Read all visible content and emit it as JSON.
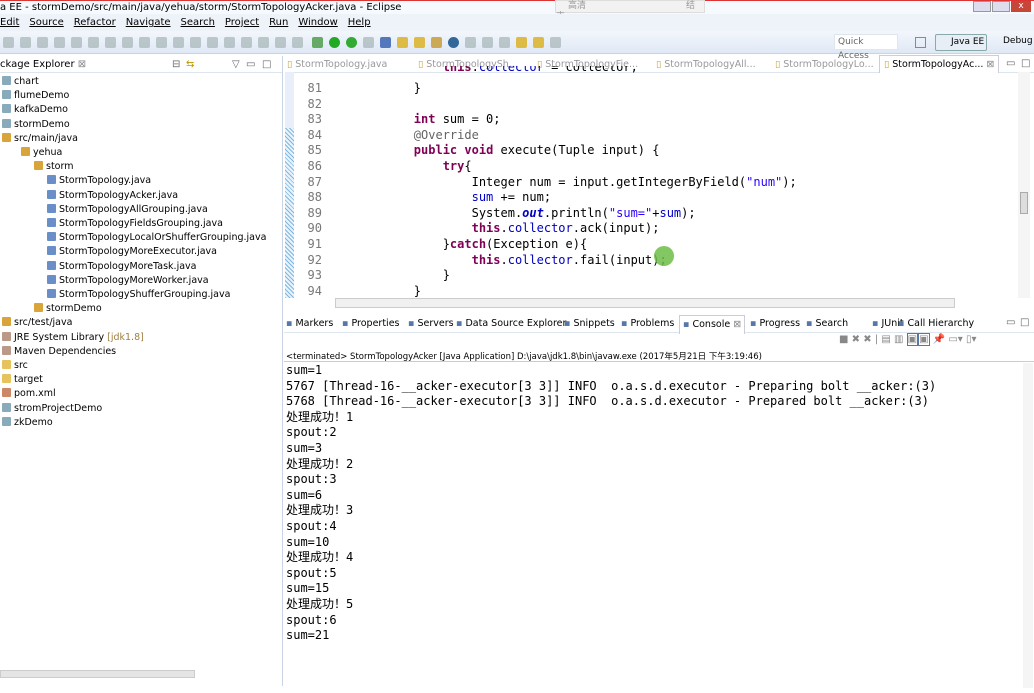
{
  "window": {
    "title": "a EE - stormDemo/src/main/java/yehua/storm/StormTopologyAcker.java - Eclipse",
    "overlay_buttons": [
      "高清",
      "",
      "",
      "",
      "结束"
    ]
  },
  "menu": [
    "Edit",
    "Source",
    "Refactor",
    "Navigate",
    "Search",
    "Project",
    "Run",
    "Window",
    "Help"
  ],
  "toolbar": {
    "quick_access_placeholder": "Quick Access",
    "perspective_active": "Java EE",
    "perspective_other": "Debug"
  },
  "explorer": {
    "title": "ckage Explorer",
    "items": [
      {
        "label": "chart",
        "depth": 0,
        "type": "project"
      },
      {
        "label": "flumeDemo",
        "depth": 0,
        "type": "project"
      },
      {
        "label": "kafkaDemo",
        "depth": 0,
        "type": "project"
      },
      {
        "label": "stormDemo",
        "depth": 0,
        "type": "project"
      },
      {
        "label": "src/main/java",
        "depth": 0,
        "type": "srcfolder"
      },
      {
        "label": "yehua",
        "depth": 1,
        "type": "package"
      },
      {
        "label": "storm",
        "depth": 2,
        "type": "package"
      },
      {
        "label": "StormTopology.java",
        "depth": 3,
        "type": "java"
      },
      {
        "label": "StormTopologyAcker.java",
        "depth": 3,
        "type": "java"
      },
      {
        "label": "StormTopologyAllGrouping.java",
        "depth": 3,
        "type": "java"
      },
      {
        "label": "StormTopologyFieldsGrouping.java",
        "depth": 3,
        "type": "java"
      },
      {
        "label": "StormTopologyLocalOrShufferGrouping.java",
        "depth": 3,
        "type": "java"
      },
      {
        "label": "StormTopologyMoreExecutor.java",
        "depth": 3,
        "type": "java"
      },
      {
        "label": "StormTopologyMoreTask.java",
        "depth": 3,
        "type": "java"
      },
      {
        "label": "StormTopologyMoreWorker.java",
        "depth": 3,
        "type": "java"
      },
      {
        "label": "StormTopologyShufferGrouping.java",
        "depth": 3,
        "type": "java"
      },
      {
        "label": "stormDemo",
        "depth": 2,
        "type": "package"
      },
      {
        "label": "src/test/java",
        "depth": 0,
        "type": "srcfolder"
      },
      {
        "label": "JRE System Library",
        "suffix": "[jdk1.8]",
        "depth": 0,
        "type": "lib"
      },
      {
        "label": "Maven Dependencies",
        "depth": 0,
        "type": "lib"
      },
      {
        "label": "src",
        "depth": 0,
        "type": "folder"
      },
      {
        "label": "target",
        "depth": 0,
        "type": "folder"
      },
      {
        "label": "pom.xml",
        "depth": 0,
        "type": "xml"
      },
      {
        "label": "stromProjectDemo",
        "depth": 0,
        "type": "project"
      },
      {
        "label": "zkDemo",
        "depth": 0,
        "type": "project"
      }
    ]
  },
  "editor": {
    "tabs": [
      "StormTopology.java",
      "StormTopologySh...",
      "StormTopologyFie...",
      "StormTopologyAll...",
      "StormTopologyLo...",
      "StormTopologyAc..."
    ],
    "active_tab": 5,
    "lines": [
      {
        "n": "81",
        "html": "        }"
      },
      {
        "n": "82",
        "html": ""
      },
      {
        "n": "83",
        "html": "        <k>int</k> sum = 0;"
      },
      {
        "n": "84",
        "html": "        <a>@Override</a>"
      },
      {
        "n": "85",
        "html": "        <k>public</k> <k>void</k> execute(Tuple input) {"
      },
      {
        "n": "86",
        "html": "            <k>try</k>{"
      },
      {
        "n": "87",
        "html": "                Integer num = input.getIntegerByField(<s>\"num\"</s>);"
      },
      {
        "n": "88",
        "html": "                <f>sum</f> += num;"
      },
      {
        "n": "89",
        "html": "                System.<i>out</i>.println(<s>\"sum=\"</s>+<f>sum</f>);"
      },
      {
        "n": "90",
        "html": "                <k>this</k>.<f>collector</f>.ack(input);"
      },
      {
        "n": "91",
        "html": "            }<k>catch</k>(Exception e){"
      },
      {
        "n": "92",
        "html": "                <k>this</k>.<f>collector</f>.fail(input);"
      },
      {
        "n": "93",
        "html": "            }"
      },
      {
        "n": "94",
        "html": "        }"
      }
    ]
  },
  "console": {
    "tabs": [
      "Markers",
      "Properties",
      "Servers",
      "Data Source Explorer",
      "Snippets",
      "Problems",
      "Console",
      "Progress",
      "Search",
      "JUnit",
      "Call Hierarchy"
    ],
    "active_tab": "Console",
    "status": "<terminated> StormTopologyAcker [Java Application] D:\\java\\jdk1.8\\bin\\javaw.exe (2017年5月21日 下午3:19:46)",
    "output": [
      "sum=1",
      "5767 [Thread-16-__acker-executor[3 3]] INFO  o.a.s.d.executor - Preparing bolt __acker:(3)",
      "5768 [Thread-16-__acker-executor[3 3]] INFO  o.a.s.d.executor - Prepared bolt __acker:(3)",
      "处理成功！1",
      "spout:2",
      "sum=3",
      "处理成功！2",
      "spout:3",
      "sum=6",
      "处理成功！3",
      "spout:4",
      "sum=10",
      "处理成功！4",
      "spout:5",
      "sum=15",
      "处理成功！5",
      "spout:6",
      "sum=21"
    ]
  }
}
